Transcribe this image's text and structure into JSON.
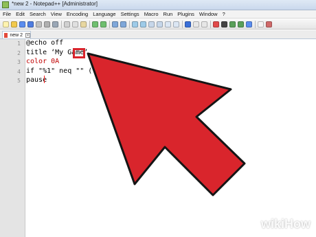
{
  "window": {
    "title": "*new 2 - Notepad++ [Administrator]"
  },
  "menu": [
    "File",
    "Edit",
    "Search",
    "View",
    "Encoding",
    "Language",
    "Settings",
    "Macro",
    "Run",
    "Plugins",
    "Window",
    "?"
  ],
  "tab": {
    "label": "new 2",
    "close_icon": "close-icon"
  },
  "editor": {
    "lines": [
      {
        "num": "1",
        "text": "@echo off"
      },
      {
        "num": "2",
        "text": "title ‘My Game’"
      },
      {
        "num": "3",
        "text": "color 0A"
      },
      {
        "num": "4",
        "text": "if \"%1\" neq \"\" ( g"
      },
      {
        "num": "5",
        "text": "pause"
      }
    ]
  },
  "annotation": {
    "color": "#d9252c",
    "arrow": "pointer-arrow"
  },
  "watermark": {
    "brand": "wikiHow"
  }
}
